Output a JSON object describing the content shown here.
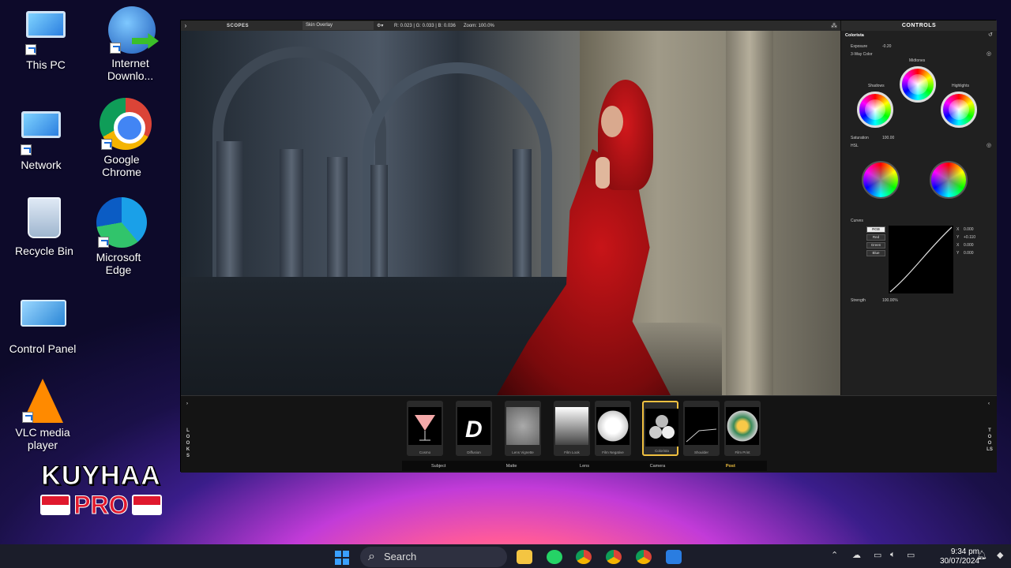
{
  "desktop": {
    "icons": [
      {
        "label": "This PC"
      },
      {
        "label": "Internet Downlo..."
      },
      {
        "label": "Network"
      },
      {
        "label": "Google Chrome"
      },
      {
        "label": "Recycle Bin"
      },
      {
        "label": "Microsoft Edge"
      },
      {
        "label": "Control Panel"
      },
      {
        "label": "VLC media player"
      }
    ],
    "brand": {
      "top": "KUYHAA",
      "bottom": "PRO"
    }
  },
  "app": {
    "topbar": {
      "scopes": "SCOPES",
      "skin": "Skin Overlay",
      "rgb": "R: 0.023 | G: 0.033 | B: 0.036",
      "zoom": "Zoom: 100.0%"
    },
    "controls": {
      "header": "CONTROLS",
      "section": "Colorista",
      "exposure_label": "Exposure",
      "exposure_value": "-0.20",
      "threeway": "3-Way Color",
      "shadows": "Shadows",
      "midtones": "Midtones",
      "highlights": "Highlights",
      "saturation_label": "Saturation",
      "saturation_value": "100.00",
      "hsl": "HSL",
      "curves": "Curves",
      "channels": [
        "RGB",
        "Red",
        "Green",
        "Blue"
      ],
      "curve_values": [
        "0.000",
        "+0.110",
        "0.000",
        "0.000"
      ],
      "curve_keys": [
        "X",
        "Y",
        "X",
        "Y"
      ],
      "strength_label": "Strength",
      "strength_value": "100.00%"
    },
    "looks": {
      "side_left": "LOOKS",
      "side_right": "TOOLS",
      "items": [
        {
          "label": "Cosmo"
        },
        {
          "label": "Diffusion"
        },
        {
          "label": "Lens Vignette"
        },
        {
          "label": "Film Look"
        },
        {
          "label": "Film Negative"
        },
        {
          "label": "Colorista"
        },
        {
          "label": "Shoulder"
        },
        {
          "label": "Film Print"
        }
      ],
      "mask_row": [
        "Subject",
        "Matte",
        "Lens",
        "Camera",
        "Post"
      ]
    }
  },
  "taskbar": {
    "search_placeholder": "Search",
    "time": "9:34 pm",
    "date": "30/07/2024"
  },
  "colors": {
    "accent": "#f0c040",
    "robe": "#c81418"
  }
}
